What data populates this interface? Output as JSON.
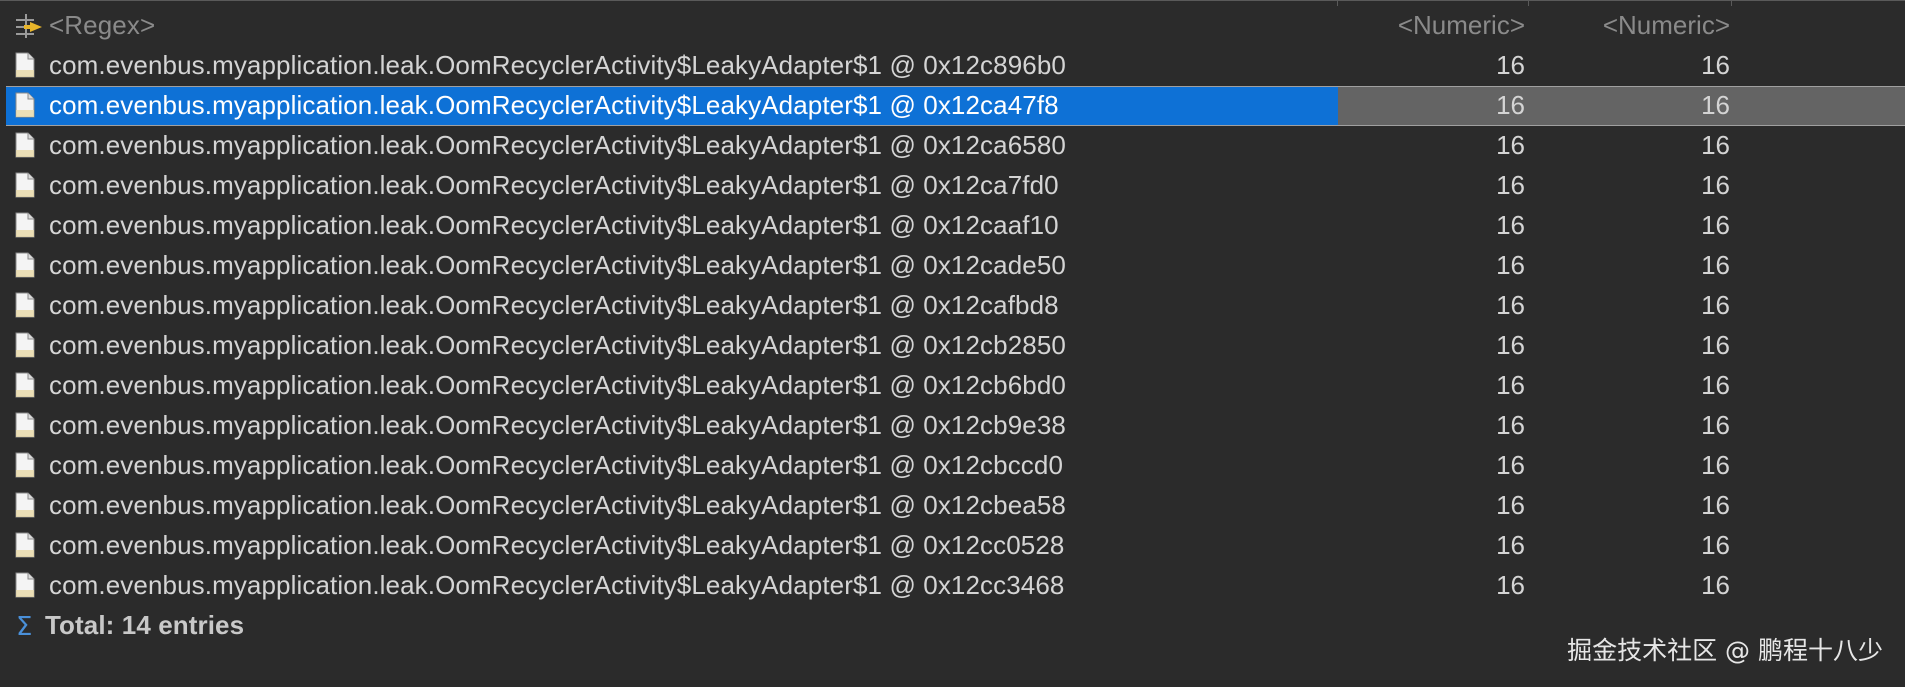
{
  "filter_row": {
    "name_placeholder": "<Regex>",
    "col1_placeholder": "<Numeric>",
    "col2_placeholder": "<Numeric>"
  },
  "rows": [
    {
      "name": "com.evenbus.myapplication.leak.OomRecyclerActivity$LeakyAdapter$1 @ 0x12c896b0",
      "shallow": "16",
      "retained": "16"
    },
    {
      "name": "com.evenbus.myapplication.leak.OomRecyclerActivity$LeakyAdapter$1 @ 0x12ca47f8",
      "shallow": "16",
      "retained": "16",
      "selected": true
    },
    {
      "name": "com.evenbus.myapplication.leak.OomRecyclerActivity$LeakyAdapter$1 @ 0x12ca6580",
      "shallow": "16",
      "retained": "16"
    },
    {
      "name": "com.evenbus.myapplication.leak.OomRecyclerActivity$LeakyAdapter$1 @ 0x12ca7fd0",
      "shallow": "16",
      "retained": "16"
    },
    {
      "name": "com.evenbus.myapplication.leak.OomRecyclerActivity$LeakyAdapter$1 @ 0x12caaf10",
      "shallow": "16",
      "retained": "16"
    },
    {
      "name": "com.evenbus.myapplication.leak.OomRecyclerActivity$LeakyAdapter$1 @ 0x12cade50",
      "shallow": "16",
      "retained": "16"
    },
    {
      "name": "com.evenbus.myapplication.leak.OomRecyclerActivity$LeakyAdapter$1 @ 0x12cafbd8",
      "shallow": "16",
      "retained": "16"
    },
    {
      "name": "com.evenbus.myapplication.leak.OomRecyclerActivity$LeakyAdapter$1 @ 0x12cb2850",
      "shallow": "16",
      "retained": "16"
    },
    {
      "name": "com.evenbus.myapplication.leak.OomRecyclerActivity$LeakyAdapter$1 @ 0x12cb6bd0",
      "shallow": "16",
      "retained": "16"
    },
    {
      "name": "com.evenbus.myapplication.leak.OomRecyclerActivity$LeakyAdapter$1 @ 0x12cb9e38",
      "shallow": "16",
      "retained": "16"
    },
    {
      "name": "com.evenbus.myapplication.leak.OomRecyclerActivity$LeakyAdapter$1 @ 0x12cbccd0",
      "shallow": "16",
      "retained": "16"
    },
    {
      "name": "com.evenbus.myapplication.leak.OomRecyclerActivity$LeakyAdapter$1 @ 0x12cbea58",
      "shallow": "16",
      "retained": "16"
    },
    {
      "name": "com.evenbus.myapplication.leak.OomRecyclerActivity$LeakyAdapter$1 @ 0x12cc0528",
      "shallow": "16",
      "retained": "16"
    },
    {
      "name": "com.evenbus.myapplication.leak.OomRecyclerActivity$LeakyAdapter$1 @ 0x12cc3468",
      "shallow": "16",
      "retained": "16"
    }
  ],
  "total": {
    "label": "Total: 14 entries"
  },
  "watermark": "掘金技术社区 @ 鹏程十八少",
  "icons": {
    "filter": "regex-filter-icon",
    "row": "object-file-icon",
    "total": "sigma-icon"
  },
  "colors": {
    "background": "#2b2b2b",
    "selection": "#0e71d6",
    "selection_inactive": "#646464",
    "text": "#d4d4d4",
    "placeholder": "#8a8a8a"
  }
}
